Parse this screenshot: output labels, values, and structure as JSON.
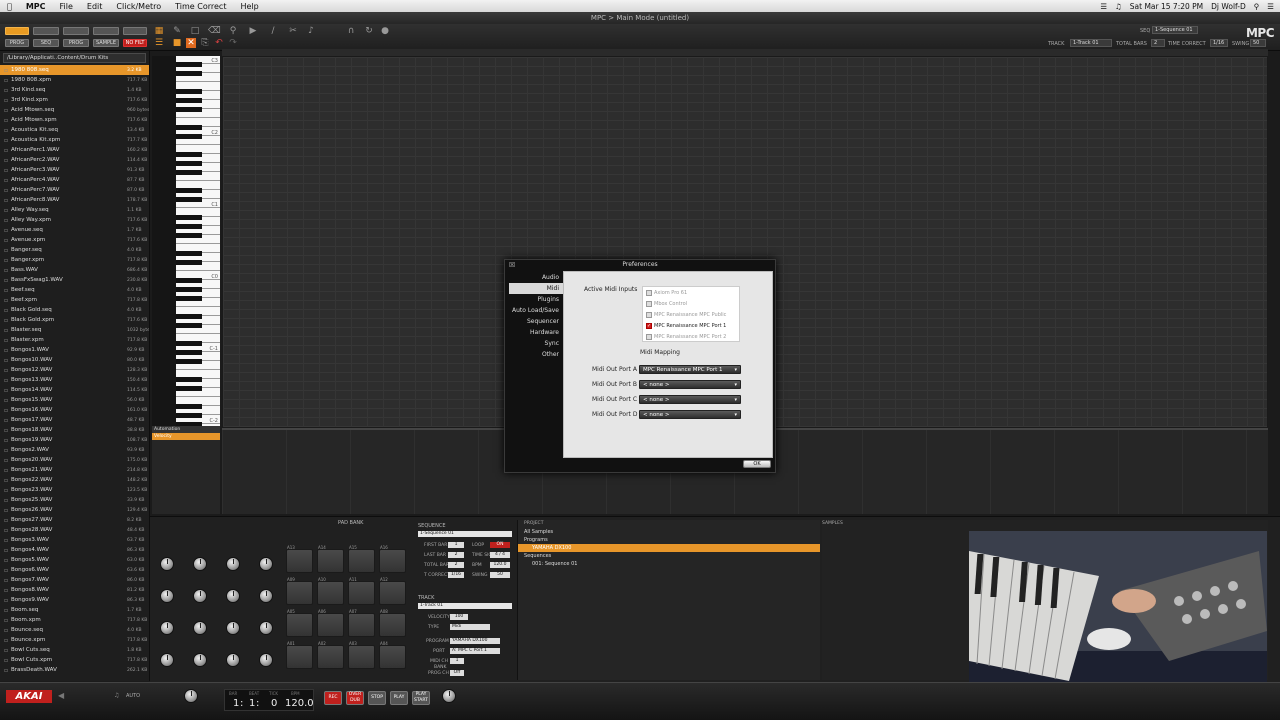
{
  "menubar": {
    "app": "MPC",
    "items": [
      "File",
      "Edit",
      "Click/Metro",
      "Time Correct",
      "Help"
    ],
    "clock": "Sat Mar 15 7:20 PM",
    "user": "Dj Wolf-D"
  },
  "window": {
    "title": "MPC > Main Mode (untitled)"
  },
  "toolbar": {
    "modes": [
      "PROG",
      "SEQ",
      "PROG",
      "SAMPLE",
      "NO FILT"
    ],
    "track_label": "TRACK",
    "track_value": "1-Track 01",
    "total_bars_label": "TOTAL BARS",
    "total_bars_value": "2",
    "time_correct_label": "TIME CORRECT",
    "time_correct_value": "1/16",
    "swing_label": "SWING",
    "swing_value": "50",
    "seq_label": "SEQ",
    "seq_value": "1-Sequence 01",
    "logo": "MPC"
  },
  "browser": {
    "path": "/Library/Applicati..Content/Drum Kits",
    "files": [
      {
        "name": "1980 808.seq",
        "size": "3.2 KB"
      },
      {
        "name": "1980 808.xpm",
        "size": "717.7 KB"
      },
      {
        "name": "3rd Kind.seq",
        "size": "1.4 KB"
      },
      {
        "name": "3rd Kind.xpm",
        "size": "717.6 KB"
      },
      {
        "name": "Acid Mtown.seq",
        "size": "960 bytes"
      },
      {
        "name": "Acid Mtown.xpm",
        "size": "717.6 KB"
      },
      {
        "name": "Acoustica Kit.seq",
        "size": "13.4 KB"
      },
      {
        "name": "Acoustica Kit.xpm",
        "size": "717.7 KB"
      },
      {
        "name": "AfricanPerc1.WAV",
        "size": "160.2 KB"
      },
      {
        "name": "AfricanPerc2.WAV",
        "size": "114.4 KB"
      },
      {
        "name": "AfricanPerc3.WAV",
        "size": "91.3 KB"
      },
      {
        "name": "AfricanPerc4.WAV",
        "size": "87.7 KB"
      },
      {
        "name": "AfricanPerc7.WAV",
        "size": "87.0 KB"
      },
      {
        "name": "AfricanPerc8.WAV",
        "size": "178.7 KB"
      },
      {
        "name": "Alley Way.seq",
        "size": "1.1 KB"
      },
      {
        "name": "Alley Way.xpm",
        "size": "717.6 KB"
      },
      {
        "name": "Avenue.seq",
        "size": "1.7 KB"
      },
      {
        "name": "Avenue.xpm",
        "size": "717.6 KB"
      },
      {
        "name": "Banger.seq",
        "size": "4.0 KB"
      },
      {
        "name": "Banger.xpm",
        "size": "717.8 KB"
      },
      {
        "name": "Bass.WAV",
        "size": "686.4 KB"
      },
      {
        "name": "BassFxSwag1.WAV",
        "size": "230.8 KB"
      },
      {
        "name": "Beef.seq",
        "size": "4.0 KB"
      },
      {
        "name": "Beef.xpm",
        "size": "717.8 KB"
      },
      {
        "name": "Black Gold.seq",
        "size": "4.0 KB"
      },
      {
        "name": "Black Gold.xpm",
        "size": "717.6 KB"
      },
      {
        "name": "Blaster.seq",
        "size": "1032 bytes"
      },
      {
        "name": "Blaster.xpm",
        "size": "717.8 KB"
      },
      {
        "name": "Bongos1.WAV",
        "size": "92.9 KB"
      },
      {
        "name": "Bongos10.WAV",
        "size": "80.0 KB"
      },
      {
        "name": "Bongos12.WAV",
        "size": "128.3 KB"
      },
      {
        "name": "Bongos13.WAV",
        "size": "150.4 KB"
      },
      {
        "name": "Bongos14.WAV",
        "size": "114.5 KB"
      },
      {
        "name": "Bongos15.WAV",
        "size": "56.0 KB"
      },
      {
        "name": "Bongos16.WAV",
        "size": "161.0 KB"
      },
      {
        "name": "Bongos17.WAV",
        "size": "48.7 KB"
      },
      {
        "name": "Bongos18.WAV",
        "size": "38.8 KB"
      },
      {
        "name": "Bongos19.WAV",
        "size": "108.7 KB"
      },
      {
        "name": "Bongos2.WAV",
        "size": "93.9 KB"
      },
      {
        "name": "Bongos20.WAV",
        "size": "175.0 KB"
      },
      {
        "name": "Bongos21.WAV",
        "size": "214.8 KB"
      },
      {
        "name": "Bongos22.WAV",
        "size": "148.2 KB"
      },
      {
        "name": "Bongos23.WAV",
        "size": "123.5 KB"
      },
      {
        "name": "Bongos25.WAV",
        "size": "33.9 KB"
      },
      {
        "name": "Bongos26.WAV",
        "size": "129.4 KB"
      },
      {
        "name": "Bongos27.WAV",
        "size": "8.2 KB"
      },
      {
        "name": "Bongos28.WAV",
        "size": "48.4 KB"
      },
      {
        "name": "Bongos3.WAV",
        "size": "63.7 KB"
      },
      {
        "name": "Bongos4.WAV",
        "size": "86.3 KB"
      },
      {
        "name": "Bongos5.WAV",
        "size": "63.0 KB"
      },
      {
        "name": "Bongos6.WAV",
        "size": "63.6 KB"
      },
      {
        "name": "Bongos7.WAV",
        "size": "86.0 KB"
      },
      {
        "name": "Bongos8.WAV",
        "size": "81.2 KB"
      },
      {
        "name": "Bongos9.WAV",
        "size": "86.3 KB"
      },
      {
        "name": "Boom.seq",
        "size": "1.7 KB"
      },
      {
        "name": "Boom.xpm",
        "size": "717.8 KB"
      },
      {
        "name": "Bounce.seq",
        "size": "4.0 KB"
      },
      {
        "name": "Bounce.xpm",
        "size": "717.8 KB"
      },
      {
        "name": "Bowl Cuts.seq",
        "size": "1.8 KB"
      },
      {
        "name": "Bowl Cuts.xpm",
        "size": "717.8 KB"
      },
      {
        "name": "BrassDeath.WAV",
        "size": "262.1 KB"
      }
    ]
  },
  "piano": {
    "octaves": [
      "C3",
      "C2",
      "C1",
      "C0",
      "C-1",
      "C-2"
    ]
  },
  "automation": {
    "title": "Automation",
    "selected": "Velocity"
  },
  "lower": {
    "pad_bank": "PAD BANK",
    "sequence_title": "SEQUENCE",
    "sequence_name": "1-Sequence 01",
    "seq_rows": [
      {
        "label": "FIRST BAR",
        "value": "1",
        "label2": "LOOP",
        "value2": "ON"
      },
      {
        "label": "LAST BAR",
        "value": "2",
        "label2": "TIME SIG",
        "value2": "4 / 4"
      },
      {
        "label": "TOTAL BARS",
        "value": "2",
        "label2": "BPM",
        "value2": "120.0"
      },
      {
        "label": "T CORRECT",
        "value": "1/16",
        "label2": "SWING",
        "value2": "50"
      }
    ],
    "track_title": "TRACK",
    "track_name": "1-Track 01",
    "velocity_label": "VELOCITY",
    "velocity_value": "100",
    "type_label": "TYPE",
    "type_value": "Midi",
    "program_label": "PROGRAM",
    "program_value": "YAMAHA DX100",
    "port_label": "PORT",
    "port_value": "A: MPC C Port 1",
    "midi_ch_label": "MIDI CH",
    "midi_ch_value": "1",
    "bank_label": "BANK",
    "prog_ch_label": "PROG CH",
    "prog_ch_value": "Off",
    "pads": [
      "A13",
      "A14",
      "A15",
      "A16",
      "A09",
      "A10",
      "A11",
      "A12",
      "A05",
      "A06",
      "A07",
      "A08",
      "A01",
      "A02",
      "A03",
      "A04"
    ]
  },
  "project": {
    "title": "PROJECT",
    "rows": [
      {
        "text": "All Samples",
        "sel": false
      },
      {
        "text": "Programs",
        "sel": false
      },
      {
        "text": "YAMAHA DX100",
        "sel": true
      },
      {
        "text": "Sequences",
        "sel": false
      },
      {
        "text": "001: Sequence 01",
        "sel": false
      }
    ]
  },
  "samples": {
    "title": "SAMPLES"
  },
  "transport": {
    "brand": "AKAI",
    "auto_label": "AUTO",
    "counter_labels": [
      "BAR",
      "BEAT",
      "TICK",
      "BPM"
    ],
    "bar": "1",
    "beat": "1",
    "tick": "0",
    "bpm": "120.0",
    "buttons": [
      "REC",
      "OVER DUB",
      "STOP",
      "PLAY",
      "PLAY START"
    ]
  },
  "prefs": {
    "title": "Preferences",
    "nav": [
      "Audio",
      "Midi",
      "Plugins",
      "Auto Load/Save",
      "Sequencer",
      "Hardware",
      "Sync",
      "Other"
    ],
    "selected_nav": "Midi",
    "active_midi_inputs_label": "Active Midi Inputs",
    "midi_inputs": [
      {
        "name": "Axiom Pro 61",
        "checked": false
      },
      {
        "name": "Mbox Control",
        "checked": false
      },
      {
        "name": "MPC Renaissance MPC Public",
        "checked": false
      },
      {
        "name": "MPC Renaissance MPC Port 1",
        "checked": true
      },
      {
        "name": "MPC Renaissance MPC Port 2",
        "checked": false
      }
    ],
    "midi_mapping_label": "Midi Mapping",
    "outputs": [
      {
        "label": "Midi Out Port A",
        "value": "MPC Renaissance MPC Port 1"
      },
      {
        "label": "Midi Out Port B",
        "value": "< none >"
      },
      {
        "label": "Midi Out Port C",
        "value": "< none >"
      },
      {
        "label": "Midi Out Port D",
        "value": "< none >"
      }
    ],
    "ok": "OK"
  },
  "colors": {
    "accent": "#e7962a",
    "rec": "#c0201d",
    "bg": "#1b1b1b"
  }
}
